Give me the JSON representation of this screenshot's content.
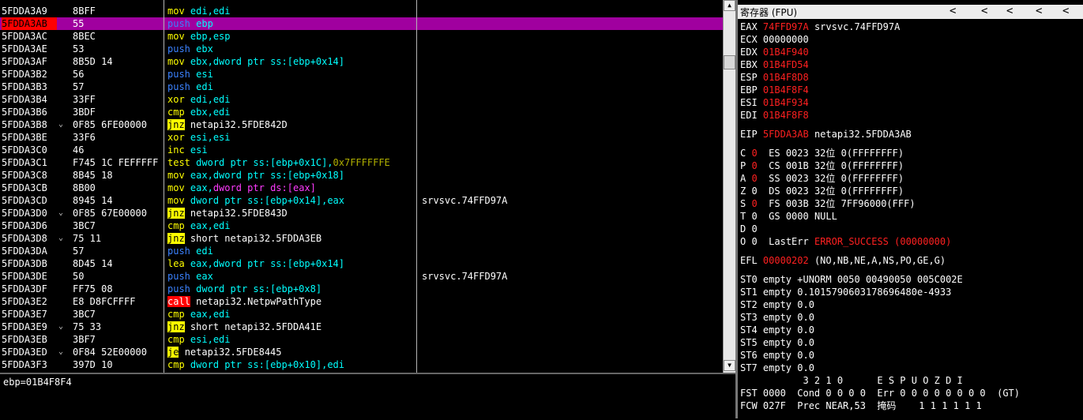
{
  "disasm": {
    "rows": [
      {
        "addr": "5FDDA3A9",
        "tri": "",
        "bytes": "8BFF",
        "mn": "mov",
        "op": "edi,edi",
        "cmt": ""
      },
      {
        "addr": "5FDDA3AB",
        "tri": "",
        "bytes": "55",
        "mn": "push",
        "op": "ebp",
        "cmt": ""
      },
      {
        "addr": "5FDDA3AC",
        "tri": "",
        "bytes": "8BEC",
        "mn": "mov",
        "op": "ebp,esp",
        "cmt": ""
      },
      {
        "addr": "5FDDA3AE",
        "tri": "",
        "bytes": "53",
        "mn": "push",
        "op": "ebx",
        "cmt": ""
      },
      {
        "addr": "5FDDA3AF",
        "tri": "",
        "bytes": "8B5D 14",
        "mn": "mov",
        "op": "ebx,dword ptr ss:[ebp+0x14]",
        "cmt": ""
      },
      {
        "addr": "5FDDA3B2",
        "tri": "",
        "bytes": "56",
        "mn": "push",
        "op": "esi",
        "cmt": ""
      },
      {
        "addr": "5FDDA3B3",
        "tri": "",
        "bytes": "57",
        "mn": "push",
        "op": "edi",
        "cmt": ""
      },
      {
        "addr": "5FDDA3B4",
        "tri": "",
        "bytes": "33FF",
        "mn": "xor",
        "op": "edi,edi",
        "cmt": ""
      },
      {
        "addr": "5FDDA3B6",
        "tri": "",
        "bytes": "3BDF",
        "mn": "cmp",
        "op": "ebx,edi",
        "cmt": ""
      },
      {
        "addr": "5FDDA3B8",
        "tri": "⌄",
        "bytes": "0F85 6FE00000",
        "mn": "jnz",
        "op": "netapi32.5FDE842D",
        "cmt": ""
      },
      {
        "addr": "5FDDA3BE",
        "tri": "",
        "bytes": "33F6",
        "mn": "xor",
        "op": "esi,esi",
        "cmt": ""
      },
      {
        "addr": "5FDDA3C0",
        "tri": "",
        "bytes": "46",
        "mn": "inc",
        "op": "esi",
        "cmt": ""
      },
      {
        "addr": "5FDDA3C1",
        "tri": "",
        "bytes": "F745 1C FEFFFFF",
        "mn": "test",
        "op": "dword ptr ss:[ebp+0x1C],",
        "op2": "0x7FFFFFFE",
        "cmt": ""
      },
      {
        "addr": "5FDDA3C8",
        "tri": "",
        "bytes": "8B45 18",
        "mn": "mov",
        "op": "eax,dword ptr ss:[ebp+0x18]",
        "cmt": ""
      },
      {
        "addr": "5FDDA3CB",
        "tri": "",
        "bytes": "8B00",
        "mn": "mov",
        "op": "eax,",
        "op2": "dword ptr ds:[eax]",
        "cmt": ""
      },
      {
        "addr": "5FDDA3CD",
        "tri": "",
        "bytes": "8945 14",
        "mn": "mov",
        "op": "dword ptr ss:[ebp+0x14],eax",
        "cmt": "srvsvc.74FFD97A"
      },
      {
        "addr": "5FDDA3D0",
        "tri": "⌄",
        "bytes": "0F85 67E00000",
        "mn": "jnz",
        "op": "netapi32.5FDE843D",
        "cmt": ""
      },
      {
        "addr": "5FDDA3D6",
        "tri": "",
        "bytes": "3BC7",
        "mn": "cmp",
        "op": "eax,edi",
        "cmt": ""
      },
      {
        "addr": "5FDDA3D8",
        "tri": "⌄",
        "bytes": "75 11",
        "mn": "jnz",
        "op": "short netapi32.5FDDA3EB",
        "cmt": ""
      },
      {
        "addr": "5FDDA3DA",
        "tri": "",
        "bytes": "57",
        "mn": "push",
        "op": "edi",
        "cmt": ""
      },
      {
        "addr": "5FDDA3DB",
        "tri": "",
        "bytes": "8D45 14",
        "mn": "lea",
        "op": "eax,dword ptr ss:[ebp+0x14]",
        "cmt": ""
      },
      {
        "addr": "5FDDA3DE",
        "tri": "",
        "bytes": "50",
        "mn": "push",
        "op": "eax",
        "cmt": "srvsvc.74FFD97A"
      },
      {
        "addr": "5FDDA3DF",
        "tri": "",
        "bytes": "FF75 08",
        "mn": "push",
        "op": "dword ptr ss:[ebp+0x8]",
        "cmt": ""
      },
      {
        "addr": "5FDDA3E2",
        "tri": "",
        "bytes": "E8 D8FCFFFF",
        "mn": "call",
        "op": "netapi32.NetpwPathType",
        "cmt": ""
      },
      {
        "addr": "5FDDA3E7",
        "tri": "",
        "bytes": "3BC7",
        "mn": "cmp",
        "op": "eax,edi",
        "cmt": ""
      },
      {
        "addr": "5FDDA3E9",
        "tri": "⌄",
        "bytes": "75 33",
        "mn": "jnz",
        "op": "short netapi32.5FDDA41E",
        "cmt": ""
      },
      {
        "addr": "5FDDA3EB",
        "tri": "",
        "bytes": "3BF7",
        "mn": "cmp",
        "op": "esi,edi",
        "cmt": ""
      },
      {
        "addr": "5FDDA3ED",
        "tri": "⌄",
        "bytes": "0F84 52E00000",
        "mn": "je",
        "op": "netapi32.5FDE8445",
        "cmt": ""
      },
      {
        "addr": "5FDDA3F3",
        "tri": "",
        "bytes": "397D 10",
        "mn": "cmp",
        "op": "dword ptr ss:[ebp+0x10],edi",
        "cmt": ""
      }
    ]
  },
  "status_text": "ebp=01B4F8F4",
  "registers": {
    "title": "寄存器 (FPU)",
    "nav": [
      "<",
      "<",
      "<",
      "<",
      "<"
    ],
    "gpr": [
      {
        "name": "EAX",
        "val": "74FFD97A",
        "info": "srvsvc.74FFD97A"
      },
      {
        "name": "ECX",
        "val": "00000000",
        "info": ""
      },
      {
        "name": "EDX",
        "val": "01B4F940",
        "info": ""
      },
      {
        "name": "EBX",
        "val": "01B4FD54",
        "info": ""
      },
      {
        "name": "ESP",
        "val": "01B4F8D8",
        "info": ""
      },
      {
        "name": "EBP",
        "val": "01B4F8F4",
        "info": ""
      },
      {
        "name": "ESI",
        "val": "01B4F934",
        "info": ""
      },
      {
        "name": "EDI",
        "val": "01B4F8F8",
        "info": ""
      }
    ],
    "eip": {
      "name": "EIP",
      "val": "5FDDA3AB",
      "info": "netapi32.5FDDA3AB"
    },
    "flags": [
      {
        "f": "C",
        "v": "0",
        "seg": "ES 0023 32位 0(FFFFFFFF)",
        "red": true
      },
      {
        "f": "P",
        "v": "0",
        "seg": "CS 001B 32位 0(FFFFFFFF)",
        "red": true
      },
      {
        "f": "A",
        "v": "0",
        "seg": "SS 0023 32位 0(FFFFFFFF)",
        "red": true
      },
      {
        "f": "Z",
        "v": "0",
        "seg": "DS 0023 32位 0(FFFFFFFF)",
        "red": false
      },
      {
        "f": "S",
        "v": "0",
        "seg": "FS 003B 32位 7FF96000(FFF)",
        "red": true
      },
      {
        "f": "T",
        "v": "0",
        "seg": "GS 0000 NULL",
        "red": false
      },
      {
        "f": "D",
        "v": "0",
        "seg": "",
        "red": false
      },
      {
        "f": "O",
        "v": "0",
        "seg": "LastErr",
        "red": false
      }
    ],
    "lasterr_val": "ERROR_SUCCESS (00000000)",
    "efl": {
      "name": "EFL",
      "val": "00000202",
      "info": "(NO,NB,NE,A,NS,PO,GE,G)"
    },
    "fpu": [
      "ST0 empty +UNORM 0050 00490050 005C002E",
      "ST1 empty 0.1015790603178696480e-4933",
      "ST2 empty 0.0",
      "ST3 empty 0.0",
      "ST4 empty 0.0",
      "ST5 empty 0.0",
      "ST6 empty 0.0",
      "ST7 empty 0.0"
    ],
    "fpu_hdr": "           3 2 1 0      E S P U O Z D I",
    "fst": "FST 0000  Cond 0 0 0 0  Err 0 0 0 0 0 0 0 0  (GT)",
    "fcw": "FCW 027F  Prec NEAR,53  掩码    1 1 1 1 1 1"
  }
}
